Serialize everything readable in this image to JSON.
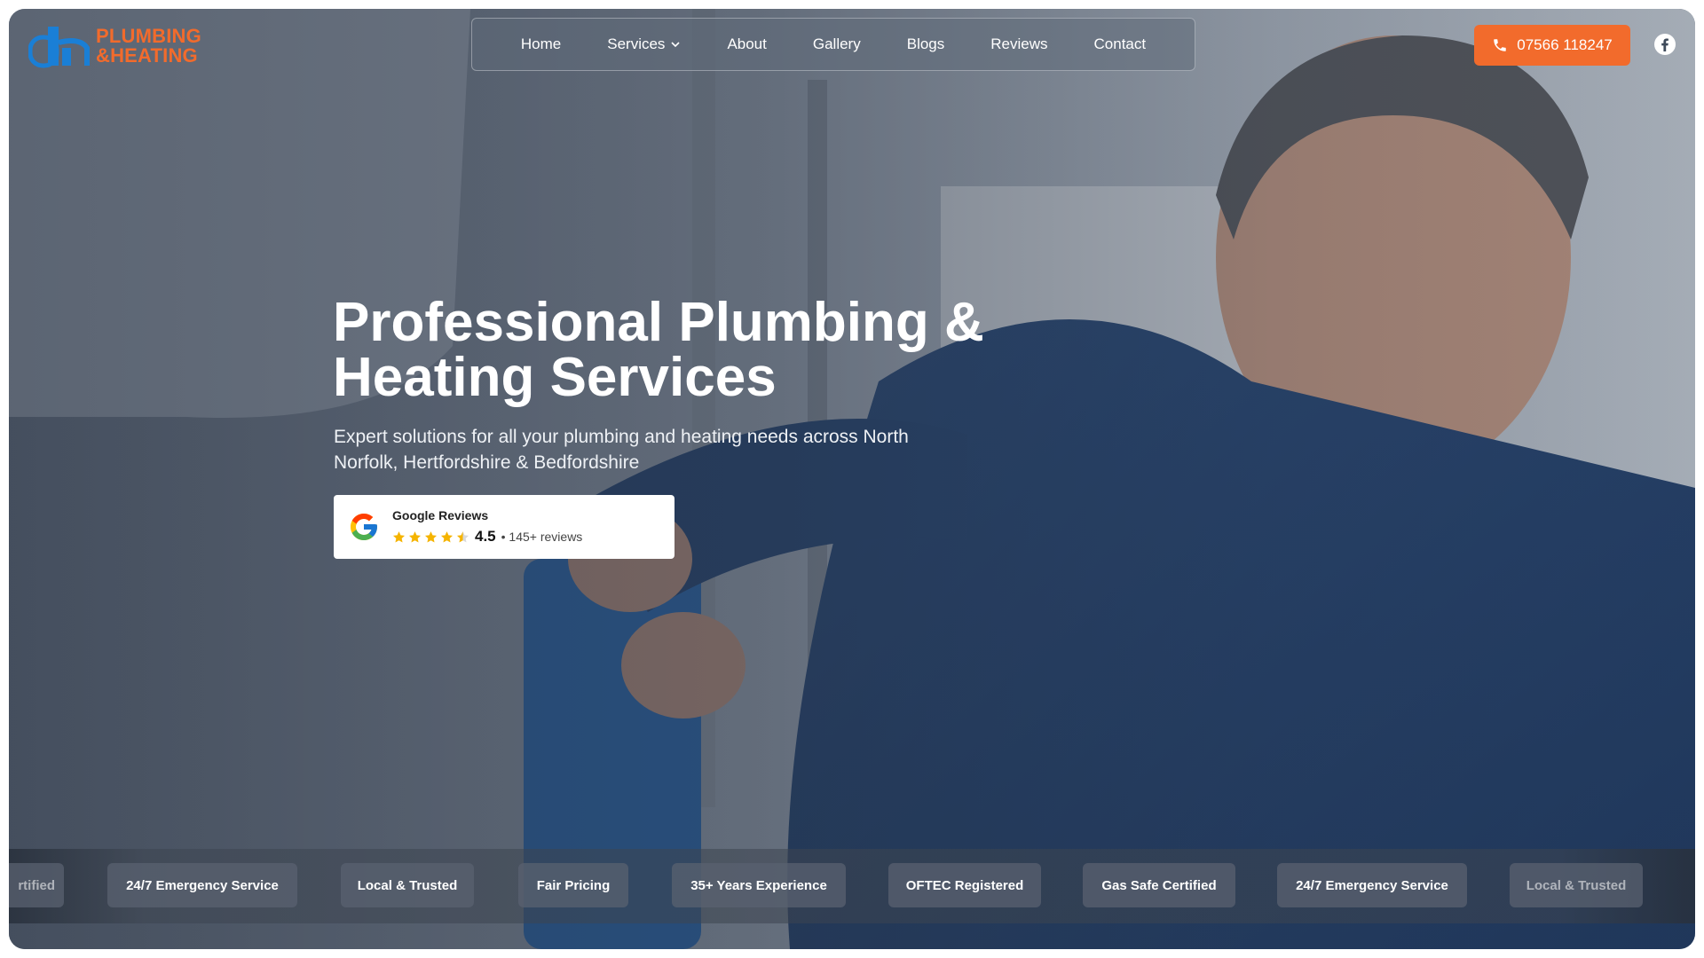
{
  "logo": {
    "line1": "PLUMBING",
    "line2": "&HEATING",
    "brand_orange": "#f26b2c",
    "brand_blue": "#1a7fd6"
  },
  "nav": {
    "items": [
      {
        "label": "Home"
      },
      {
        "label": "Services"
      },
      {
        "label": "About"
      },
      {
        "label": "Gallery"
      },
      {
        "label": "Blogs"
      },
      {
        "label": "Reviews"
      },
      {
        "label": "Contact"
      }
    ]
  },
  "header": {
    "phone": "07566 118247",
    "social_icon": "facebook-icon"
  },
  "hero": {
    "title": "Professional Plumbing & Heating Services",
    "subtitle": "Expert solutions for all your plumbing and heating needs across North Norfolk, Hertfordshire & Bedfordshire"
  },
  "reviews": {
    "title": "Google Reviews",
    "rating": "4.5",
    "count": "• 145+ reviews",
    "star_rating": 4.5
  },
  "badges": [
    "rtified",
    "24/7 Emergency Service",
    "Local & Trusted",
    "Fair Pricing",
    "35+ Years Experience",
    "OFTEC Registered",
    "Gas Safe Certified",
    "24/7 Emergency Service",
    "Local & Trusted"
  ]
}
